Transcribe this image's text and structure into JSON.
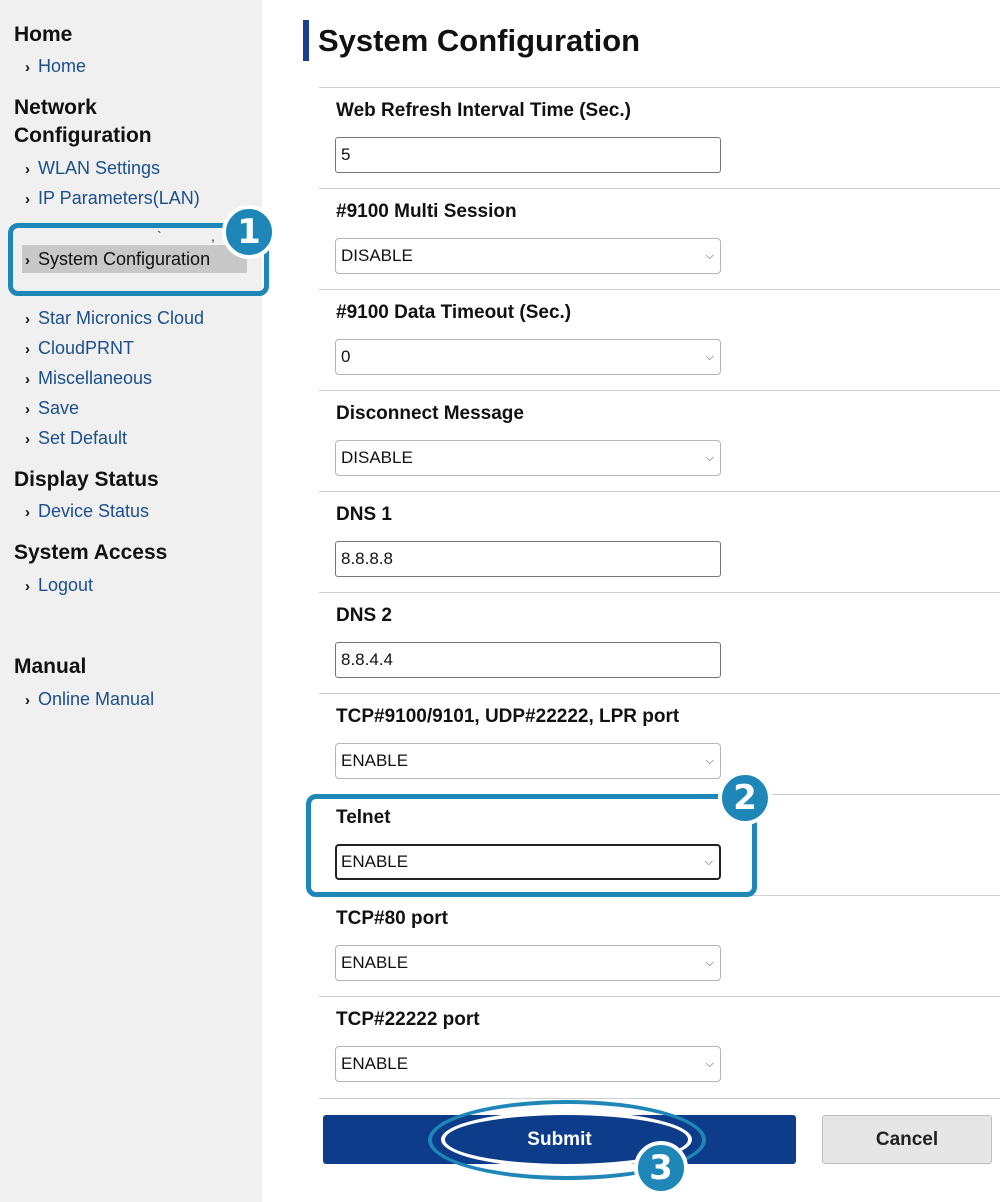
{
  "sidebar": {
    "home_heading": "Home",
    "home_link": "Home",
    "network_heading_line1": "Network",
    "network_heading_line2": "Configuration",
    "wlan": "WLAN Settings",
    "ip": "IP Parameters(LAN)",
    "system_configuration": "System Configuration",
    "star_cloud": "Star Micronics Cloud",
    "cloudprnt": "CloudPRNT",
    "misc": "Miscellaneous",
    "save": "Save",
    "set_default": "Set Default",
    "display_heading": "Display Status",
    "device_status": "Device Status",
    "access_heading": "System Access",
    "logout": "Logout",
    "manual_heading": "Manual",
    "online_manual": "Online Manual"
  },
  "callouts": {
    "one": "1",
    "two": "2",
    "three": "3",
    "color": "#1f86b8"
  },
  "main": {
    "title": "System Configuration",
    "fields": [
      {
        "label": "Web Refresh Interval Time (Sec.)",
        "value": "5"
      },
      {
        "label": "#9100 Multi Session",
        "value": "DISABLE"
      },
      {
        "label": "#9100 Data Timeout (Sec.)",
        "value": "0"
      },
      {
        "label": "Disconnect Message",
        "value": "DISABLE"
      },
      {
        "label": "DNS 1",
        "value": "8.8.8.8"
      },
      {
        "label": "DNS 2",
        "value": "8.8.4.4"
      },
      {
        "label": "TCP#9100/9101, UDP#22222, LPR port",
        "value": "ENABLE"
      },
      {
        "label": "Telnet",
        "value": "ENABLE"
      },
      {
        "label": "TCP#80 port",
        "value": "ENABLE"
      },
      {
        "label": "TCP#22222 port",
        "value": "ENABLE"
      }
    ],
    "submit": "Submit",
    "cancel": "Cancel"
  },
  "colors": {
    "accent": "#0d3d8a",
    "link": "#1a4f8c",
    "callout": "#1f86b8"
  }
}
